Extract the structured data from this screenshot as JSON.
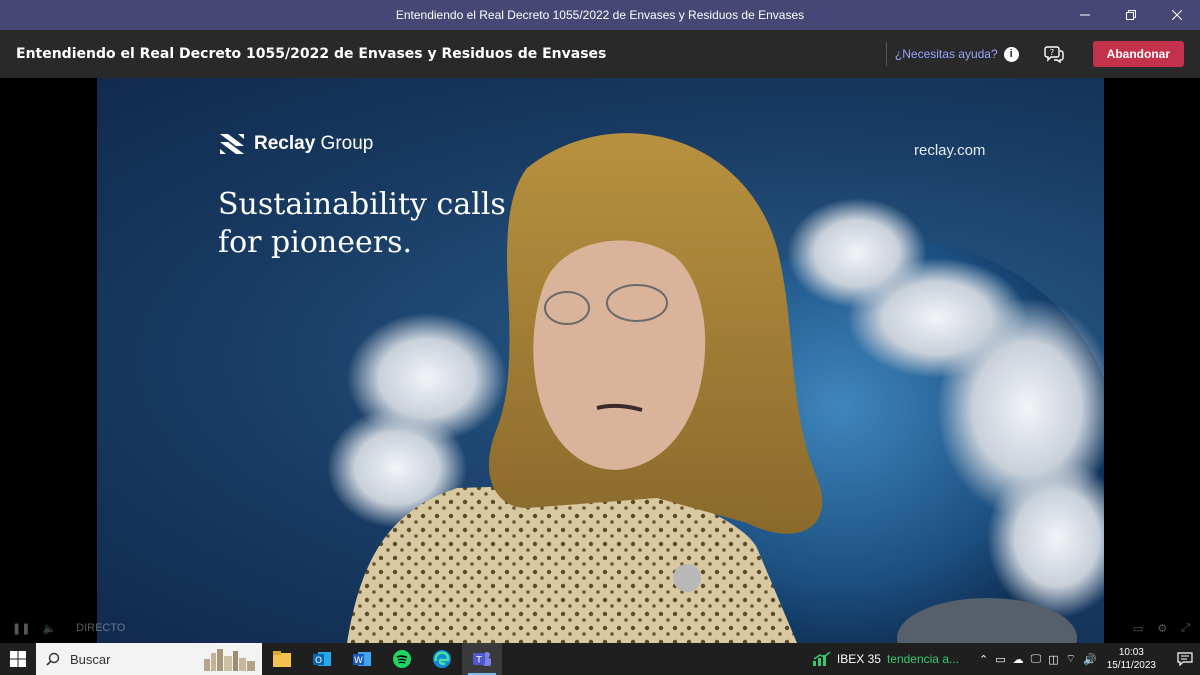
{
  "window": {
    "title": "Entendiendo el Real Decreto 1055/2022 de Envases y Residuos de Envases",
    "controls": [
      "minimize",
      "restore",
      "close"
    ]
  },
  "header": {
    "event_title": "Entendiendo el Real Decreto 1055/2022 de Envases y Residuos de Envases",
    "help_label": "¿Necesitas ayuda?",
    "info_icon": "i",
    "leave_label": "Abandonar",
    "leave_color": "#c4314b"
  },
  "video": {
    "brand_bold": "Reclay",
    "brand_regular": " Group",
    "url": "reclay.com",
    "slogan_line1": "Sustainability calls",
    "slogan_line2": "for pioneers."
  },
  "player": {
    "live_label": "DIRECTO"
  },
  "taskbar": {
    "search_placeholder": "Buscar",
    "apps": [
      "file-explorer",
      "outlook",
      "word",
      "spotify",
      "edge",
      "teams"
    ],
    "active_app": "teams",
    "stock_name": "IBEX 35",
    "stock_trend": "tendencia a...",
    "time": "10:03",
    "date": "15/11/2023"
  }
}
